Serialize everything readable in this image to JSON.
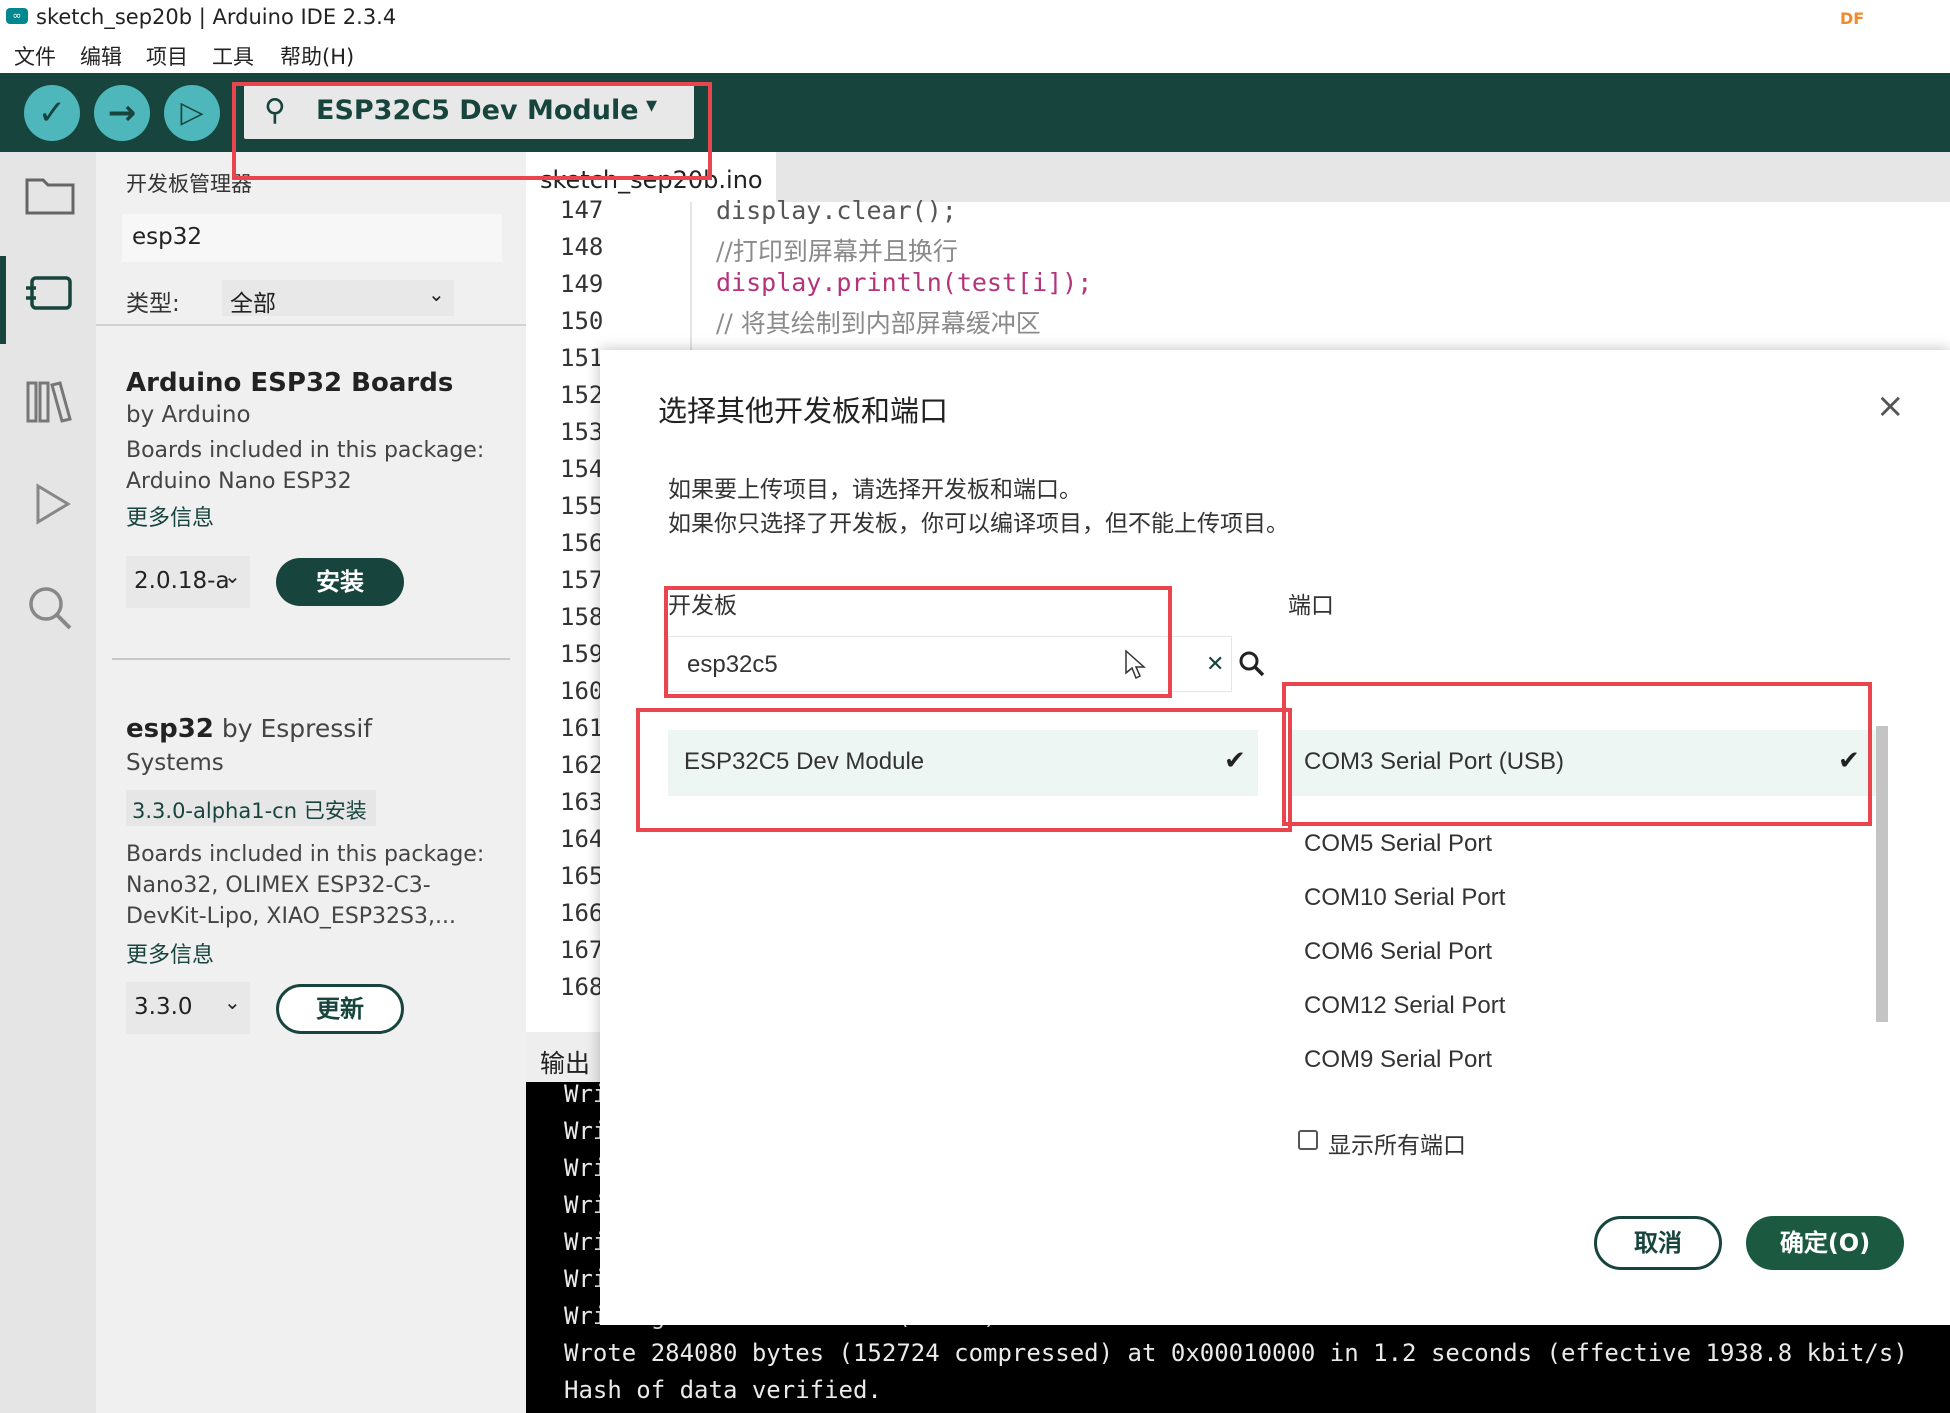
{
  "window": {
    "title": "sketch_sep20b | Arduino IDE 2.3.4",
    "logo": "∞",
    "badge": "DF"
  },
  "menu": [
    "文件",
    "编辑",
    "项目",
    "工具",
    "帮助(H)"
  ],
  "toolbar": {
    "selected_board": "ESP32C5 Dev Module",
    "verify_icon": "✓",
    "upload_icon": "→",
    "debug_icon": "▷",
    "usb_icon": "⚲",
    "caret": "▾"
  },
  "boards_manager": {
    "title": "开发板管理器",
    "search_value": "esp32",
    "type_label": "类型:",
    "type_value": "全部",
    "packages": [
      {
        "name": "Arduino ESP32 Boards",
        "author": "by Arduino",
        "desc_title": "Boards included in this package:",
        "boards": "Arduino Nano ESP32",
        "more": "更多信息",
        "version": "2.0.18-a",
        "action": "安装"
      },
      {
        "name": "esp32",
        "author_1": " by Espressif",
        "author_2": "Systems",
        "installed": "3.3.0-alpha1-cn 已安装",
        "desc_title": "Boards included in this package:",
        "boards_1": "Nano32, OLIMEX ESP32-C3-",
        "boards_2": "DevKit-Lipo, XIAO_ESP32S3,...",
        "more": "更多信息",
        "version": "3.3.0",
        "action": "更新"
      }
    ]
  },
  "editor": {
    "tab": "sketch_sep20b.ino",
    "lines": [
      "147",
      "148",
      "149",
      "150",
      "151",
      "152",
      "153",
      "154",
      "155",
      "156",
      "157",
      "158",
      "159",
      "160",
      "161",
      "162",
      "163",
      "164",
      "165",
      "166",
      "167",
      "168"
    ],
    "code": [
      "display.clear();",
      "//打印到屏幕并且换行",
      "display.println(test[i]);",
      "// 将其绘制到内部屏幕缓冲区"
    ]
  },
  "output": {
    "title": "输出",
    "lines": [
      "Wri",
      "Wri",
      "Wri",
      "Wri",
      "Wri",
      "Wri",
      "Writing at 0x000...... (100 %)",
      "Wrote 284080 bytes (152724 compressed) at 0x00010000 in 1.2 seconds (effective 1938.8 kbit/s)",
      "Hash of data verified."
    ]
  },
  "dialog": {
    "title": "选择其他开发板和端口",
    "close_icon": "×",
    "desc_1": "如果要上传项目，请选择开发板和端口。",
    "desc_2": "如果你只选择了开发板，你可以编译项目，但不能上传项目。",
    "board_label": "开发板",
    "board_search": "esp32c5",
    "clear_icon": "✕",
    "search_icon": "⌕",
    "boards": [
      "ESP32C5 Dev Module"
    ],
    "port_label": "端口",
    "ports": [
      "COM3 Serial Port (USB)",
      "COM5 Serial Port",
      "COM10 Serial Port",
      "COM6 Serial Port",
      "COM12 Serial Port",
      "COM9 Serial Port"
    ],
    "check_icon": "✔",
    "show_all_ports": "显示所有端口",
    "cancel": "取消",
    "ok": "确定(O)"
  }
}
